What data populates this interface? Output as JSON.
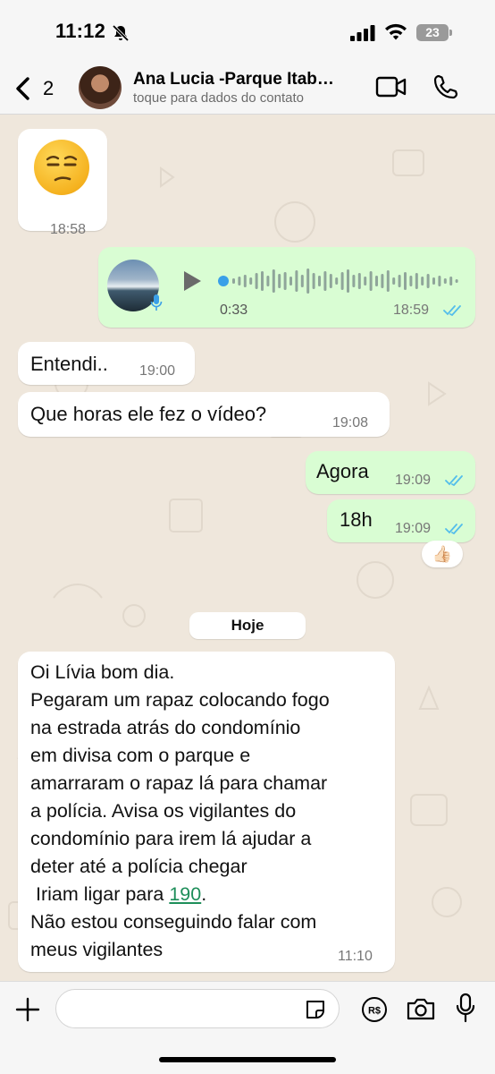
{
  "status_bar": {
    "time": "11:12",
    "battery": "23"
  },
  "header": {
    "back_count": "2",
    "contact_name": "Ana Lucia -Parque Itab…",
    "contact_subtitle": "toque para dados do contato"
  },
  "messages": [
    {
      "id": "m1",
      "direction": "in",
      "emoji": "😒",
      "time": "18:58"
    },
    {
      "id": "m2",
      "direction": "out",
      "type": "voice",
      "duration": "0:33",
      "time": "18:59",
      "read": true
    },
    {
      "id": "m3",
      "direction": "in",
      "text": "Entendi..",
      "time": "19:00"
    },
    {
      "id": "m4",
      "direction": "in",
      "text": "Que horas ele fez o vídeo?",
      "time": "19:08"
    },
    {
      "id": "m5",
      "direction": "out",
      "text": "Agora",
      "time": "19:09",
      "read": true
    },
    {
      "id": "m6",
      "direction": "out",
      "text": "18h",
      "time": "19:09",
      "read": true,
      "reaction": "👍🏻"
    }
  ],
  "date_divider": "Hoje",
  "long_message": {
    "lines": [
      "Oi Lívia bom dia.",
      "Pegaram um rapaz colocando fogo",
      "na estrada atrás do condomínio",
      "em divisa com o parque e",
      "amarraram o rapaz lá para chamar",
      "a polícia. Avisa os vigilantes do",
      "condomínio para irem lá ajudar a",
      "deter até a polícia chegar"
    ],
    "call_prefix": " Iriam ligar para ",
    "call_number": "190",
    "call_suffix": ".",
    "lines_after": [
      "Não estou conseguindo falar com",
      "meus vigilantes"
    ],
    "time": "11:10"
  },
  "composer": {
    "placeholder": ""
  },
  "colors": {
    "outgoing_bubble": "#d9fdd3",
    "incoming_bubble": "#ffffff",
    "read_ticks": "#53bdeb",
    "link": "#1e8e5a"
  },
  "icons": [
    "bell-off-icon",
    "signal-icon",
    "wifi-icon",
    "battery-icon",
    "chevron-left-icon",
    "video-camera-icon",
    "phone-icon",
    "play-icon",
    "microphone-icon",
    "double-check-icon",
    "plus-icon",
    "sticker-icon",
    "payment-icon",
    "camera-icon"
  ]
}
